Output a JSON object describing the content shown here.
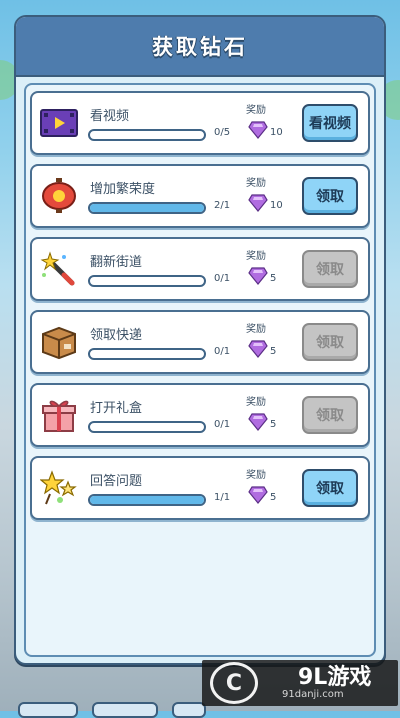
{
  "dialog": {
    "title": "获取钻石"
  },
  "tasks": [
    {
      "label": "看视频",
      "progress_text": "0/5",
      "progress": 0,
      "reward_label": "奖励",
      "reward": "10",
      "button": "看视频",
      "state": "active",
      "icon": "video-icon"
    },
    {
      "label": "增加繁荣度",
      "progress_text": "2/1",
      "progress": 1,
      "reward_label": "奖励",
      "reward": "10",
      "button": "领取",
      "state": "active",
      "icon": "lantern-icon"
    },
    {
      "label": "翻新街道",
      "progress_text": "0/1",
      "progress": 0,
      "reward_label": "奖励",
      "reward": "5",
      "button": "领取",
      "state": "disabled",
      "icon": "magic-wand-icon"
    },
    {
      "label": "领取快递",
      "progress_text": "0/1",
      "progress": 0,
      "reward_label": "奖励",
      "reward": "5",
      "button": "领取",
      "state": "disabled",
      "icon": "package-icon"
    },
    {
      "label": "打开礼盒",
      "progress_text": "0/1",
      "progress": 0,
      "reward_label": "奖励",
      "reward": "5",
      "button": "领取",
      "state": "disabled",
      "icon": "gift-box-icon"
    },
    {
      "label": "回答问题",
      "progress_text": "1/1",
      "progress": 1,
      "reward_label": "奖励",
      "reward": "5",
      "button": "领取",
      "state": "active",
      "icon": "stars-icon"
    }
  ],
  "watermark": {
    "logo_letter": "C",
    "brand": "9L游戏",
    "url": "91danji.com"
  },
  "colors": {
    "header": "#4e7cad",
    "accent_button": "#8fd4f7",
    "disabled_button": "#c4c4c4",
    "gem": "#b06ce0",
    "progress_fill": "#61b8e9"
  }
}
